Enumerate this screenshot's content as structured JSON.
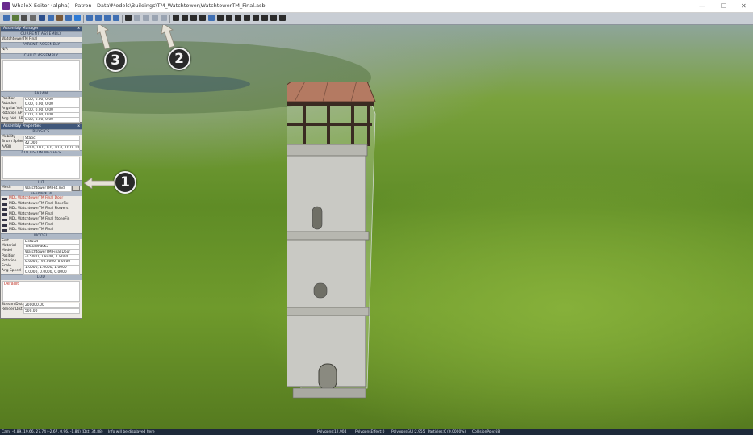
{
  "window": {
    "title": "WhaleX Editor (alpha) - Patron - Data\\Models\\Buildings\\TM_Watchtower\\WatchtowerTM_Final.asb",
    "minimize": "—",
    "maximize": "☐",
    "close": "✕"
  },
  "toolbar": {
    "buttons": [
      {
        "icon": "tool-icon",
        "color": "#3f6fb3"
      },
      {
        "icon": "terrain-icon",
        "color": "#5a7a3a"
      },
      {
        "icon": "brush-icon",
        "color": "#4d4d4d"
      },
      {
        "icon": "sphere-icon",
        "color": "#6a6a6a"
      },
      {
        "icon": "figure-icon",
        "color": "#2c4f8c"
      },
      {
        "icon": "flip-icon",
        "color": "#3f6fb3"
      },
      {
        "icon": "hand-icon",
        "color": "#7a5a3a"
      },
      {
        "icon": "transform-icon",
        "color": "#3f6fb3"
      },
      {
        "icon": "rotate-icon",
        "color": "#2e7bd6"
      },
      {
        "icon": "move-x-icon",
        "color": "#3f6fb3"
      },
      {
        "icon": "move-y-icon",
        "color": "#3f6fb3"
      },
      {
        "icon": "move-z-icon",
        "color": "#3f6fb3"
      },
      {
        "icon": "move-all-icon",
        "color": "#3f6fb3"
      },
      {
        "icon": "save-icon",
        "color": "#2b2b2b"
      },
      {
        "icon": "circle-icon",
        "color": "#9aa4b2"
      },
      {
        "icon": "lasso-icon",
        "color": "#9aa4b2"
      },
      {
        "icon": "link-icon",
        "color": "#9aa4b2"
      },
      {
        "icon": "chain-icon",
        "color": "#9aa4b2"
      },
      {
        "icon": "wrench-icon",
        "color": "#2b2b2b"
      },
      {
        "icon": "play-icon",
        "color": "#2b2b2b"
      },
      {
        "icon": "record-icon",
        "color": "#2b2b2b"
      },
      {
        "icon": "pen-icon",
        "color": "#2b2b2b"
      },
      {
        "icon": "ruler-icon",
        "color": "#3f6fb3"
      },
      {
        "icon": "rect-select-icon",
        "color": "#2b2b2b"
      },
      {
        "icon": "gear-icon",
        "color": "#2b2b2b"
      },
      {
        "icon": "reload-icon",
        "color": "#2b2b2b"
      },
      {
        "icon": "grid-icon",
        "color": "#2b2b2b"
      },
      {
        "icon": "vr-icon",
        "color": "#2b2b2b"
      },
      {
        "icon": "eye-icon",
        "color": "#2b2b2b"
      },
      {
        "icon": "glasses-icon",
        "color": "#2b2b2b"
      },
      {
        "icon": "help-icon",
        "color": "#2b2b2b"
      }
    ]
  },
  "assembly_manager": {
    "title": "Assembly Manager",
    "current_assembly_header": "CURRENT ASSEMBLY",
    "current_assembly_value": "WatchtowerTM Final",
    "parent_assembly_header": "PARENT ASSEMBLY",
    "parent_assembly_value": "N/A",
    "child_assembly_header": "CHILD ASSEMBLY",
    "param_header": "PARAM",
    "params": [
      {
        "k": "Position",
        "v": "0.00, 0.00, 0.00"
      },
      {
        "k": "Rotation",
        "v": "0.00, 0.00, 0.00"
      },
      {
        "k": "Angular Vel.",
        "v": "0.00, 0.00, 0.00"
      },
      {
        "k": "Rotation AP",
        "v": "0.00, 0.00, 0.00"
      },
      {
        "k": "Ang. Vel. AP",
        "v": "0.00, 0.00, 0.00"
      }
    ]
  },
  "assembly_properties": {
    "title": "Assembly Properties",
    "physics_header": "PHYSICS",
    "physics": [
      {
        "k": "Mobility",
        "v": "Static"
      },
      {
        "k": "Bnum Sphere",
        "v": "42.000"
      },
      {
        "k": "AABB",
        "v": "-10.0, 10.0, 0.0, 10.0, 10.0, 10"
      }
    ],
    "collision_header": "COLLISION MESHES",
    "hit_header": "HIT",
    "hit_mesh_label": "Mesh",
    "hit_mesh_value": "WatchtowerTM Hit.mdl",
    "elements_header": "ELEMENTS",
    "elements": [
      "MDL WatchtowerTM Final Door",
      "MDL WatchtowerTM Final FloorFix",
      "MDL WatchtowerTM Final Flowers",
      "MDL WatchtowerTM Final",
      "MDL WatchtowerTM Final StoneFin",
      "MDL WatchtowerTM Final",
      "MDL WatchtowerTM Final"
    ],
    "model_header": "MODEL",
    "model": [
      {
        "k": "Sort",
        "v": "Default"
      },
      {
        "k": "Material",
        "v": "TexturePack5"
      },
      {
        "k": "Model",
        "v": "WatchtowerTM Final Door"
      },
      {
        "k": "Position",
        "v": "-0.5000, 1.8400, 1.8000"
      },
      {
        "k": "Rotation",
        "v": "0.0000, -90.0000, 0.0000"
      },
      {
        "k": "Scale",
        "v": "1.0000, 1.0000, 1.0000"
      },
      {
        "k": "Ang Speed",
        "v": "0.0000, 0.0000, 0.0000"
      }
    ],
    "lod_header": "LOD",
    "lod_default": "Default",
    "stream_dist_label": "Stream Dist",
    "stream_dist_value": "200000.00",
    "render_dist_label": "Render Dist",
    "render_dist_value": "500.00"
  },
  "callouts": [
    "1",
    "2",
    "3"
  ],
  "status": {
    "cam": "Cam: -6.89, 19.66, 27.74 (-2.67, 0.96, -1.84) (Dst: 34.88)",
    "info": "Info will be displayed here",
    "polygons": "Polygons:12,904",
    "polygon_effect": "PolygonsEffect:0",
    "polygon_gui": "PolygonsGUI:2,955",
    "particles": "Particles:0 (0.0000%)",
    "collision": "CollisionPoly:68"
  }
}
